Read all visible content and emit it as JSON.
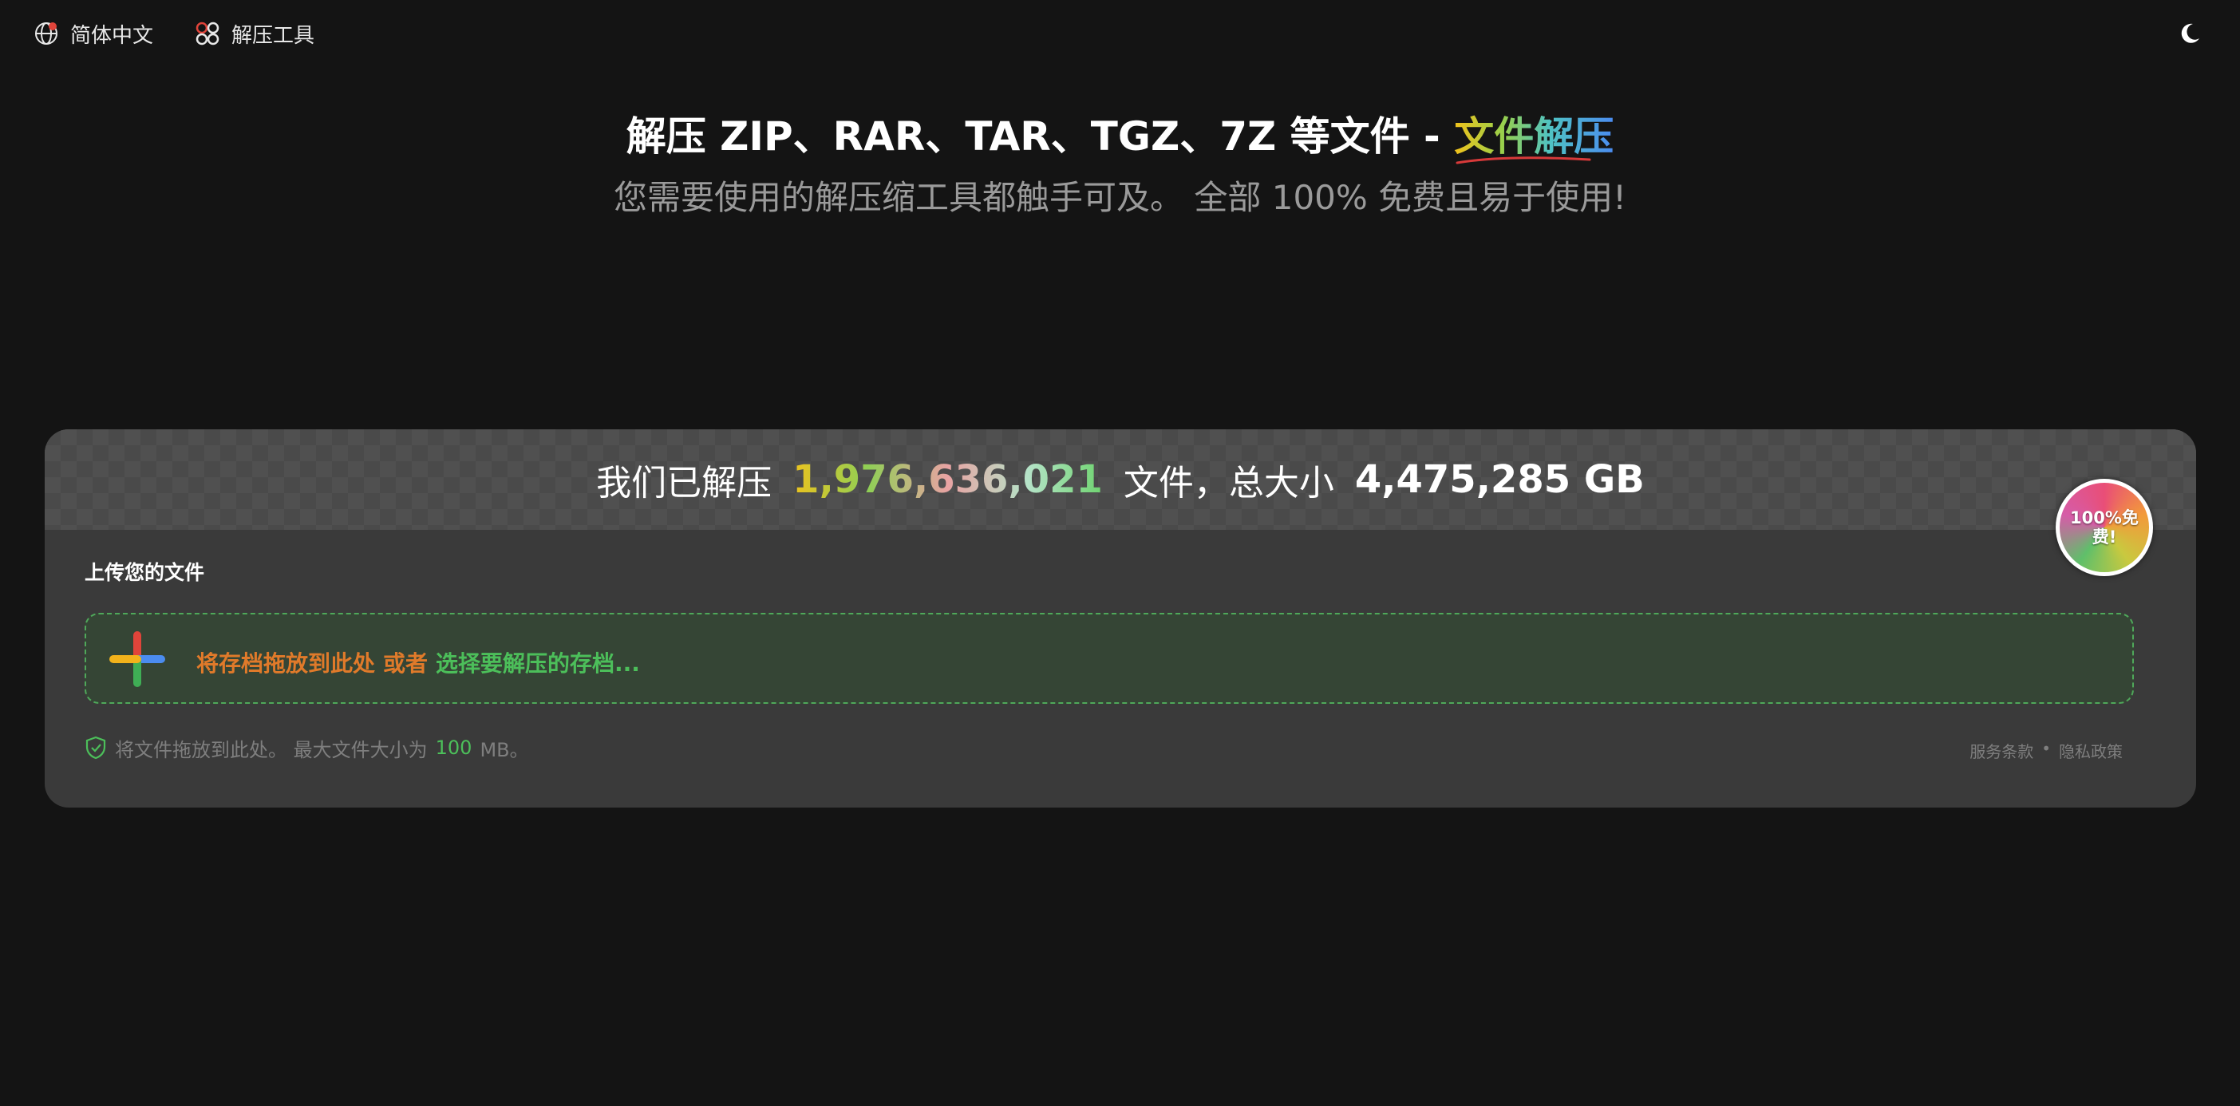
{
  "nav": {
    "language_label": "简体中文",
    "tools_label": "解压工具",
    "language_icon": "globe-icon",
    "tools_icon": "grid-icon",
    "theme_icon": "moon-icon"
  },
  "hero": {
    "title_prefix": "解压 ZIP、RAR、TAR、TGZ、7Z 等文件 - ",
    "title_highlight": "文件解压",
    "subtitle": "您需要使用的解压缩工具都触手可及。 全部 100% 免费且易于使用!"
  },
  "stats": {
    "prefix": "我们已解压",
    "file_count": "1,976,636,021",
    "middle": "文件，总大小",
    "total_size": "4,475,285 GB"
  },
  "badge": {
    "text": "100%免费!"
  },
  "upload": {
    "label": "上传您的文件",
    "drag_text": "将存档拖放到此处",
    "or_text": "或者",
    "choose_text": "选择要解压的存档...",
    "icon": "plus-icon"
  },
  "footer": {
    "note_prefix": "将文件拖放到此处。 最大文件大小为",
    "max_size": "100",
    "note_suffix": "MB。",
    "shield_icon": "shield-check-icon",
    "terms_label": "服务条款",
    "separator": "•",
    "privacy_label": "隐私政策"
  },
  "colors": {
    "background": "#141414",
    "card": "#3a3a3a",
    "accent_green": "#4cbf5a",
    "accent_orange": "#e07a2a"
  }
}
